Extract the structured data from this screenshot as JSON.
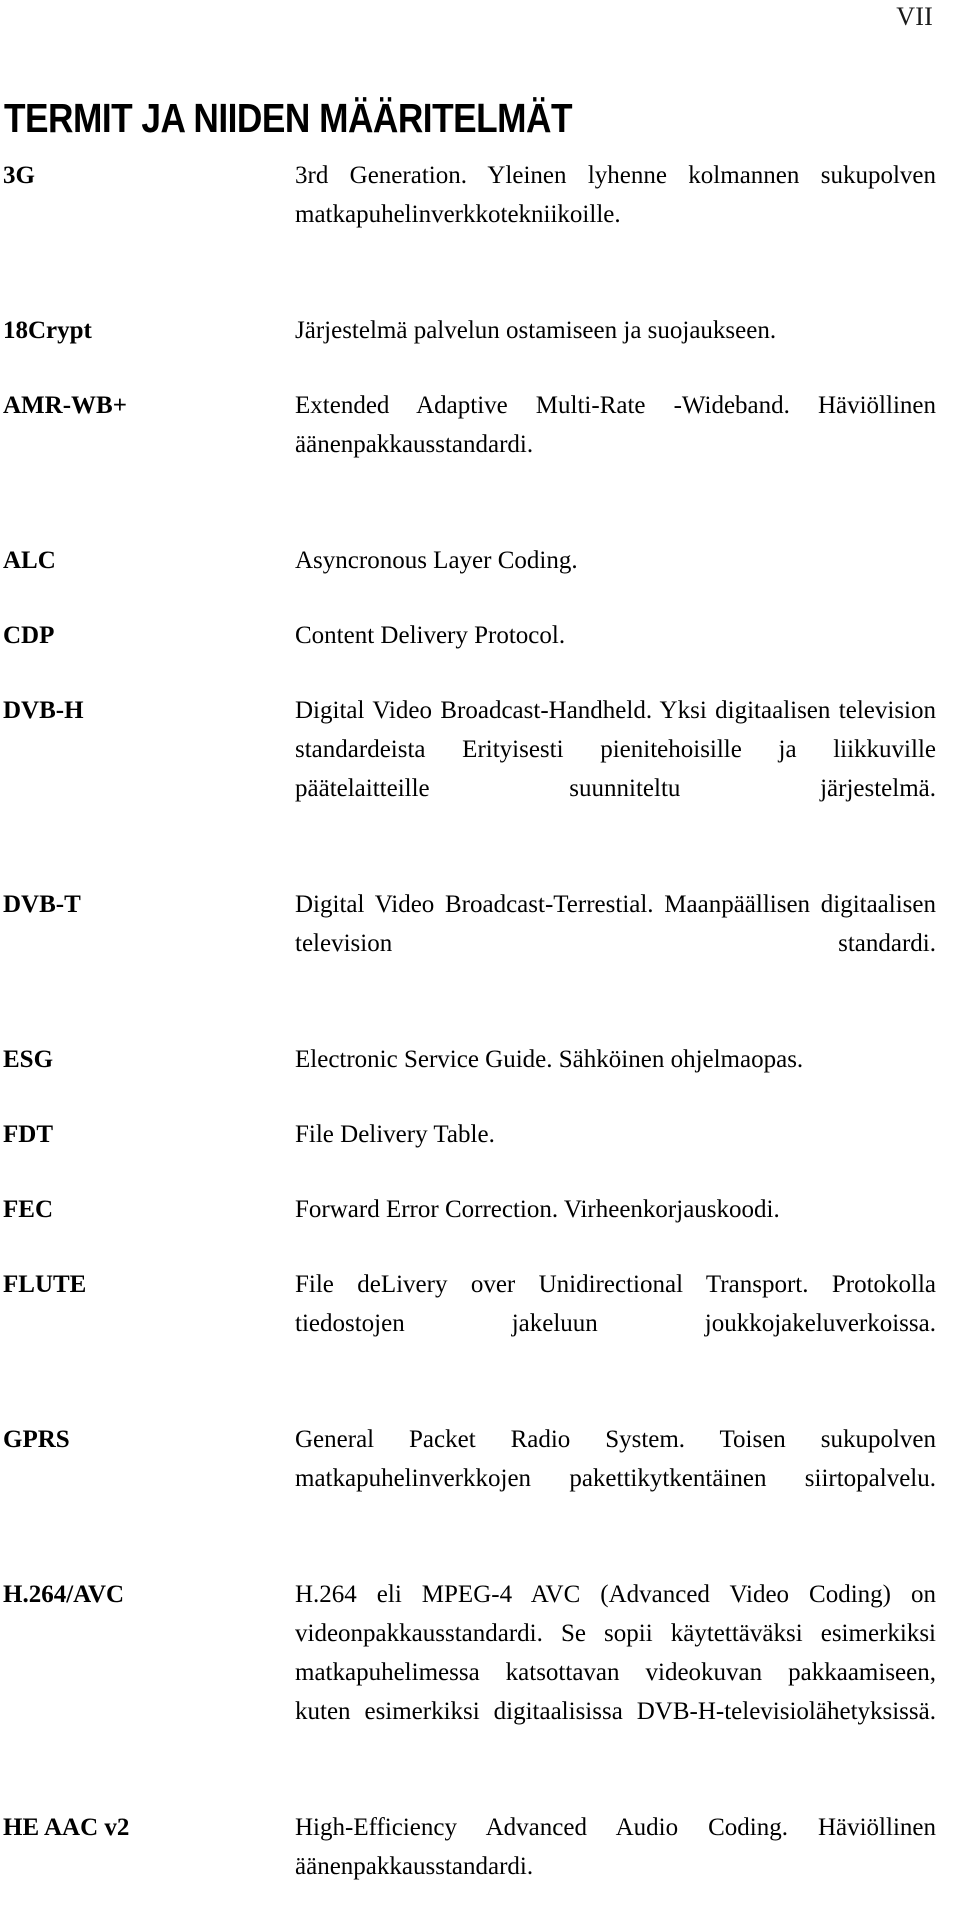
{
  "page": {
    "page_number": "VII",
    "title": "TERMIT JA NIIDEN MÄÄRITELMÄT"
  },
  "glossary": {
    "entries": [
      {
        "term": "3G",
        "definition": "3rd Generation. Yleinen lyhenne kolmannen sukupolven matkapuhelinverkkotekniikoille.",
        "multiline": true
      },
      {
        "term": "18Crypt",
        "definition": "Järjestelmä palvelun ostamiseen ja suojaukseen.",
        "multiline": false
      },
      {
        "term": "AMR-WB+",
        "definition": "Extended Adaptive Multi-Rate -Wideband. Häviöllinen äänenpakkausstandardi.",
        "multiline": true
      },
      {
        "term": "ALC",
        "definition": "Asyncronous Layer Coding.",
        "multiline": false
      },
      {
        "term": "CDP",
        "definition": "Content Delivery Protocol.",
        "multiline": false
      },
      {
        "term": "DVB-H",
        "definition": "Digital Video Broadcast-Handheld.  Yksi digitaalisen television standardeista Erityisesti pienitehoisille ja liikkuville päätelaitteille suunniteltu järjestelmä.",
        "multiline": true
      },
      {
        "term": "DVB-T",
        "definition": "Digital Video Broadcast-Terrestial.  Maanpäällisen digitaalisen television standardi.",
        "multiline": true
      },
      {
        "term": "ESG",
        "definition": "Electronic Service Guide. Sähköinen ohjelmaopas.",
        "multiline": false
      },
      {
        "term": "FDT",
        "definition": "File Delivery Table.",
        "multiline": false
      },
      {
        "term": "FEC",
        "definition": "Forward Error Correction. Virheenkorjauskoodi.",
        "multiline": false
      },
      {
        "term": "FLUTE",
        "definition": "File deLivery over Unidirectional Transport. Protokolla tiedostojen jakeluun joukkojakeluverkoissa.",
        "multiline": true
      },
      {
        "term": "GPRS",
        "definition": "General Packet Radio System. Toisen sukupolven matkapuhelinverkkojen pakettikytkentäinen siirtopalvelu.",
        "multiline": true
      },
      {
        "term": "H.264/AVC",
        "definition": "H.264 eli MPEG-4 AVC (Advanced Video Coding) on videonpakkausstandardi. Se sopii käytettäväksi esimerkiksi matkapuhelimessa katsottavan videokuvan pakkaamiseen, kuten esimerkiksi digitaalisissa DVB-H-televisiolähetyksissä.",
        "multiline": true
      },
      {
        "term": "HE AAC v2",
        "definition": "High-Efficiency Advanced Audio Coding. Häviöllinen äänenpakkausstandardi.",
        "multiline": true
      }
    ]
  }
}
